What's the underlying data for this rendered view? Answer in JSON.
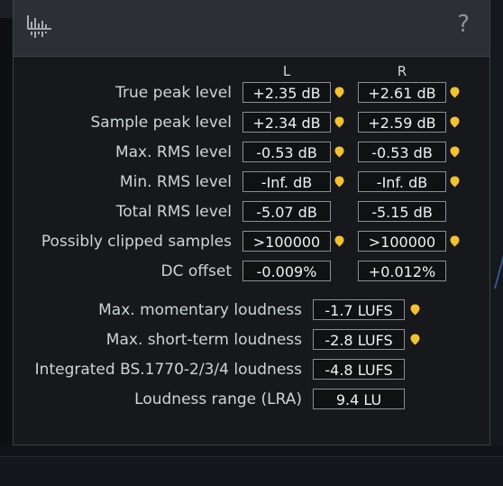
{
  "help_symbol": "?",
  "columns": {
    "left": "L",
    "right": "R"
  },
  "channel_rows": [
    {
      "label": "True peak level",
      "left": "+2.35 dB",
      "right": "+2.61 dB",
      "left_marker": true,
      "right_marker": true
    },
    {
      "label": "Sample peak level",
      "left": "+2.34 dB",
      "right": "+2.59 dB",
      "left_marker": true,
      "right_marker": true
    },
    {
      "label": "Max. RMS level",
      "left": "-0.53 dB",
      "right": "-0.53 dB",
      "left_marker": true,
      "right_marker": true
    },
    {
      "label": "Min. RMS level",
      "left": "-Inf. dB",
      "right": "-Inf. dB",
      "left_marker": true,
      "right_marker": true
    },
    {
      "label": "Total RMS level",
      "left": "-5.07 dB",
      "right": "-5.15 dB",
      "left_marker": false,
      "right_marker": false
    },
    {
      "label": "Possibly clipped samples",
      "left": ">100000",
      "right": ">100000",
      "left_marker": true,
      "right_marker": true
    },
    {
      "label": "DC offset",
      "left": "-0.009%",
      "right": "+0.012%",
      "left_marker": false,
      "right_marker": false
    }
  ],
  "loudness_rows": [
    {
      "label": "Max. momentary loudness",
      "value": "-1.7 LUFS",
      "marker": true
    },
    {
      "label": "Max. short-term loudness",
      "value": "-2.8 LUFS",
      "marker": true
    },
    {
      "label": "Integrated BS.1770-2/3/4 loudness",
      "value": "-4.8 LUFS",
      "marker": false
    },
    {
      "label": "Loudness range (LRA)",
      "value": "9.4 LU",
      "marker": false
    }
  ],
  "colors": {
    "marker": "#f2c230",
    "dialog_bg": "#16181b",
    "titlebar_bg": "#2c3035",
    "field_border": "#8a8f96"
  },
  "icons": {
    "logo": "waveform-analyzer-icon",
    "help": "help-icon",
    "marker": "marker-pin-icon"
  }
}
